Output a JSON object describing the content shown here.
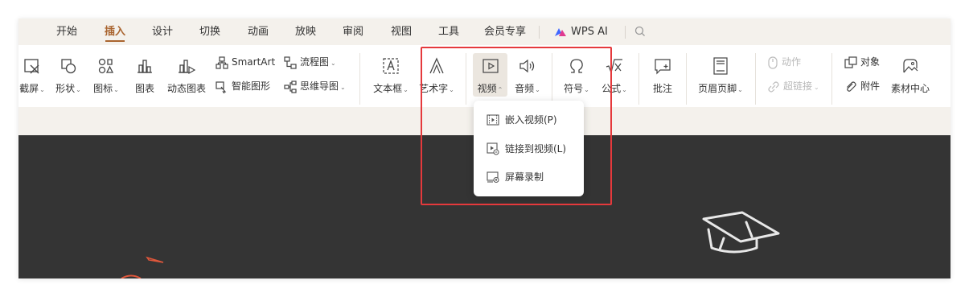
{
  "tabs": [
    "开始",
    "插入",
    "设计",
    "切换",
    "动画",
    "放映",
    "审阅",
    "视图",
    "工具",
    "会员专享"
  ],
  "active_tab": "插入",
  "wps_ai_label": "WPS AI",
  "ribbon": {
    "screenshot": "截屏",
    "shape": "形状",
    "icon": "图标",
    "chart": "图表",
    "dynamic_chart": "动态图表",
    "smartart": "SmartArt",
    "smart_shape": "智能图形",
    "flowchart": "流程图",
    "mindmap": "思维导图",
    "textbox": "文本框",
    "wordart": "艺术字",
    "video": "视频",
    "audio": "音频",
    "symbol": "符号",
    "formula": "公式",
    "comment": "批注",
    "header_footer": "页眉页脚",
    "action": "动作",
    "hyperlink": "超链接",
    "object": "对象",
    "attachment": "附件",
    "material_center": "素材中心"
  },
  "video_menu": {
    "items": [
      "嵌入视频(P)",
      "链接到视频(L)",
      "屏幕录制"
    ]
  },
  "colors": {
    "accent": "#a9642f",
    "highlight_box": "#e5393c",
    "slide_bg": "#343434"
  }
}
